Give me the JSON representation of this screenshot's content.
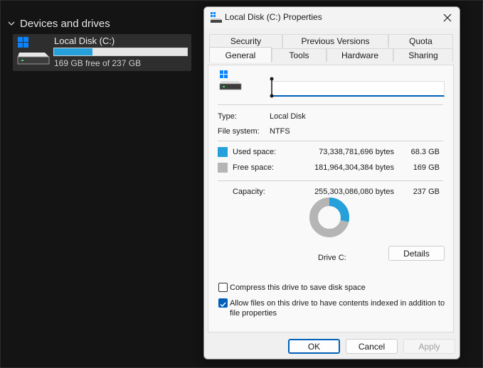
{
  "explorer": {
    "section_title": "Devices and drives",
    "drive": {
      "name": "Local Disk (C:)",
      "free_text": "169 GB free of 237 GB",
      "used_fraction": 0.287
    }
  },
  "dialog": {
    "title": "Local Disk (C:) Properties",
    "tabs_row1": [
      "Security",
      "Previous Versions",
      "Quota"
    ],
    "tabs_row2": [
      "General",
      "Tools",
      "Hardware",
      "Sharing"
    ],
    "active_tab": "General",
    "name_value": "",
    "type_label": "Type:",
    "type_value": "Local Disk",
    "fs_label": "File system:",
    "fs_value": "NTFS",
    "used_label": "Used space:",
    "used_bytes": "73,338,781,696 bytes",
    "used_size": "68.3 GB",
    "free_label": "Free space:",
    "free_bytes": "181,964,304,384 bytes",
    "free_size": "169 GB",
    "capacity_label": "Capacity:",
    "capacity_bytes": "255,303,086,080 bytes",
    "capacity_size": "237 GB",
    "used_fraction": 0.2873,
    "drive_label": "Drive C:",
    "details_button": "Details",
    "compress_label": "Compress this drive to save disk space",
    "compress_checked": false,
    "index_label": "Allow files on this drive to have contents indexed in addition to file properties",
    "index_checked": true,
    "ok_button": "OK",
    "cancel_button": "Cancel",
    "apply_button": "Apply"
  },
  "colors": {
    "used": "#26a0da",
    "free": "#b5b5b5",
    "accent": "#005fb8"
  }
}
